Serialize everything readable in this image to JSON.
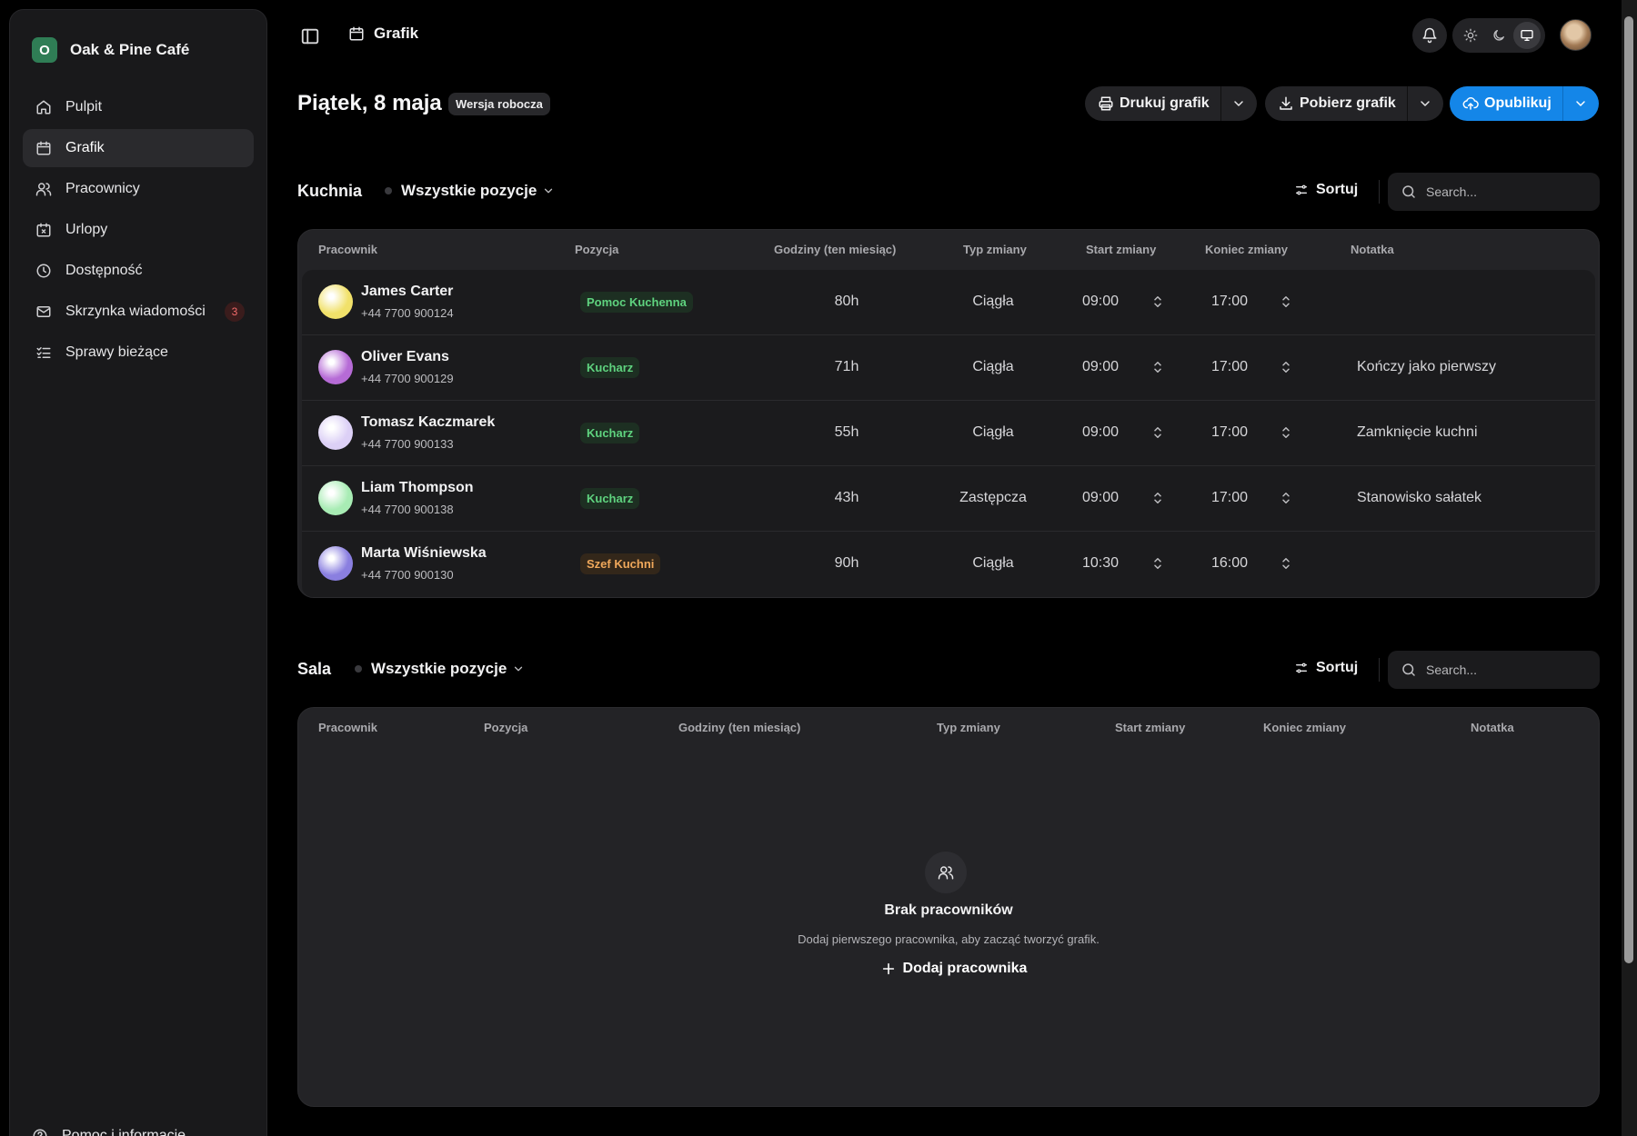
{
  "sidebar": {
    "brand": {
      "initial": "O",
      "name": "Oak & Pine Café"
    },
    "items": [
      {
        "label": "Pulpit",
        "icon": "home-icon"
      },
      {
        "label": "Grafik",
        "icon": "calendar-icon",
        "active": true
      },
      {
        "label": "Pracownicy",
        "icon": "users-icon"
      },
      {
        "label": "Urlopy",
        "icon": "calendar-x-icon"
      },
      {
        "label": "Dostępność",
        "icon": "clock-icon"
      },
      {
        "label": "Skrzynka wiadomości",
        "icon": "mail-icon",
        "badge": "3"
      },
      {
        "label": "Sprawy bieżące",
        "icon": "list-check-icon"
      }
    ],
    "footer": {
      "label": "Pomoc i informacje",
      "icon": "help-icon"
    }
  },
  "topbar": {
    "breadcrumb": "Grafik",
    "theme_options": [
      "sun-icon",
      "moon-icon",
      "monitor-icon"
    ],
    "theme_active": "monitor-icon"
  },
  "header": {
    "title": "Piątek, 8 maja",
    "badge": "Wersja robocza",
    "print_label": "Drukuj grafik",
    "download_label": "Pobierz grafik",
    "publish_label": "Opublikuj",
    "accent": "#1486e8"
  },
  "columns": [
    "Pracownik",
    "Pozycja",
    "Godziny (ten miesiąc)",
    "Typ zmiany",
    "Start zmiany",
    "Koniec zmiany",
    "Notatka"
  ],
  "kitchen": {
    "title": "Kuchnia",
    "filter": "Wszystkie pozycje",
    "sort_label": "Sortuj",
    "search_placeholder": "Search...",
    "rows": [
      {
        "name": "James Carter",
        "phone": "+44 7700 900124",
        "role": "Pomoc Kuchenna",
        "role_color": "green",
        "hours": "80h",
        "type": "Ciągła",
        "start": "09:00",
        "end": "17:00",
        "note": "",
        "avatar": "#f1e16a"
      },
      {
        "name": "Oliver Evans",
        "phone": "+44 7700 900129",
        "role": "Kucharz",
        "role_color": "green",
        "hours": "71h",
        "type": "Ciągła",
        "start": "09:00",
        "end": "17:00",
        "note": "Kończy jako pierwszy",
        "avatar": "#b66bd6"
      },
      {
        "name": "Tomasz Kaczmarek",
        "phone": "+44 7700 900133",
        "role": "Kucharz",
        "role_color": "green",
        "hours": "55h",
        "type": "Ciągła",
        "start": "09:00",
        "end": "17:00",
        "note": "Zamknięcie kuchni",
        "avatar": "#dcd0f6"
      },
      {
        "name": "Liam Thompson",
        "phone": "+44 7700 900138",
        "role": "Kucharz",
        "role_color": "green",
        "hours": "43h",
        "type": "Zastępcza",
        "start": "09:00",
        "end": "17:00",
        "note": "Stanowisko sałatek",
        "avatar": "#a8ecb4"
      },
      {
        "name": "Marta Wiśniewska",
        "phone": "+44 7700 900130",
        "role": "Szef Kuchni",
        "role_color": "orange",
        "hours": "90h",
        "type": "Ciągła",
        "start": "10:30",
        "end": "16:00",
        "note": "",
        "avatar": "#8a7fe0"
      }
    ]
  },
  "hall": {
    "title": "Sala",
    "filter": "Wszystkie pozycje",
    "sort_label": "Sortuj",
    "search_placeholder": "Search...",
    "empty": {
      "title": "Brak pracowników",
      "description": "Dodaj pierwszego pracownika, aby zacząć tworzyć grafik.",
      "button": "Dodaj pracownika"
    }
  }
}
